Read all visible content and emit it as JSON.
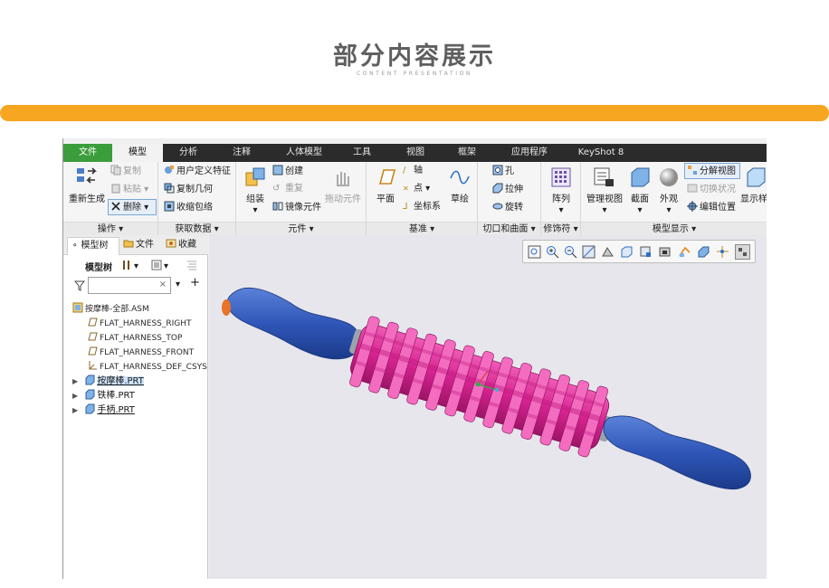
{
  "header": {
    "title": "部分内容展示",
    "subtitle": "CONTENT PRESENTATION"
  },
  "colors": {
    "accent_bar": "#f6a620",
    "menubar": "#2b2b2b",
    "file_tab": "#3c9d3c",
    "model_blue": "#2f56b8",
    "roller_magenta": "#d6228f"
  },
  "menubar": {
    "tabs": [
      "文件",
      "模型",
      "分析",
      "注释",
      "人体模型",
      "工具",
      "视图",
      "框架",
      "应用程序",
      "KeyShot 8"
    ],
    "active": "模型"
  },
  "ribbon": {
    "operation": {
      "regenerate": "重新生成",
      "copy": "复制",
      "paste": "粘贴",
      "delete": "删除",
      "label": "操作"
    },
    "get_data": {
      "udf": "用户定义特征",
      "copy_geom": "复制几何",
      "shrinkwrap": "收缩包络",
      "label": "获取数据"
    },
    "component": {
      "assemble": "组装",
      "create": "创建",
      "repeat": "重复",
      "mirror": "镜像元件",
      "drag": "拖动元件",
      "label": "元件"
    },
    "datum": {
      "plane": "平面",
      "axis": "轴",
      "point": "点",
      "csys": "坐标系",
      "sketch": "草绘",
      "label": "基准"
    },
    "cut_surface": {
      "hole": "孔",
      "extrude": "拉伸",
      "revolve": "旋转",
      "label": "切口和曲面"
    },
    "modifier": {
      "pattern": "阵列",
      "label": "修饰符"
    },
    "model_display": {
      "manage_views": "管理视图",
      "section": "截面",
      "appearance": "外观",
      "explode": "分解视图",
      "toggle_status": "切换状况",
      "edit_position": "编辑位置",
      "display_style": "显示样式",
      "label": "模型显示"
    }
  },
  "left_panel": {
    "tabs": [
      "模型树",
      "文件",
      "收藏"
    ],
    "tree_title": "模型树",
    "search_placeholder": "",
    "tree": [
      {
        "label": "按摩棒-全部.ASM",
        "kind": "asm"
      },
      {
        "label": "FLAT_HARNESS_RIGHT",
        "kind": "plane"
      },
      {
        "label": "FLAT_HARNESS_TOP",
        "kind": "plane"
      },
      {
        "label": "FLAT_HARNESS_FRONT",
        "kind": "plane"
      },
      {
        "label": "FLAT_HARNESS_DEF_CSYS",
        "kind": "csys"
      },
      {
        "label": "按摩棒.PRT",
        "kind": "part"
      },
      {
        "label": "铁棒.PRT",
        "kind": "part"
      },
      {
        "label": "手柄.PRT",
        "kind": "part"
      }
    ]
  },
  "viewport": {
    "toolbar_icons": [
      "refit-icon",
      "zoom-in-icon",
      "zoom-out-icon",
      "repaint-icon",
      "display-style-icon",
      "saved-orientations-icon",
      "view-manager-icon",
      "perspective-icon",
      "annotation-display-icon",
      "datum-display-icon",
      "spin-center-icon",
      "appearance-icon",
      "explode-icon"
    ]
  }
}
